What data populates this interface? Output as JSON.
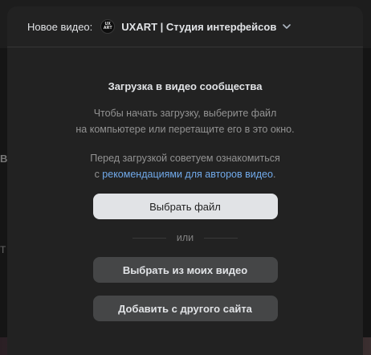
{
  "header": {
    "label": "Новое видео:",
    "avatar_line1": "UX",
    "avatar_line2": "ART",
    "community_name": "UXART | Студия интерфейсов"
  },
  "body": {
    "title": "Загрузка в видео сообщества",
    "desc_line1": "Чтобы начать загрузку, выберите файл",
    "desc_line2": "на компьютере или перетащите его в это окно.",
    "advice_line1": "Перед загрузкой советуем ознакомиться",
    "advice_prefix": "с ",
    "advice_link": "рекомендациями для авторов видео",
    "advice_suffix": ".",
    "choose_file_label": "Выбрать файл",
    "or_label": "или",
    "from_my_videos_label": "Выбрать из моих видео",
    "from_other_site_label": "Добавить с другого сайта"
  },
  "background": {
    "left_char1": "В",
    "left_char2": "Т"
  },
  "colors": {
    "modal_bg": "#222222",
    "primary_button": "#e1e3e6",
    "secondary_button": "#454647",
    "link": "#71aaeb"
  }
}
